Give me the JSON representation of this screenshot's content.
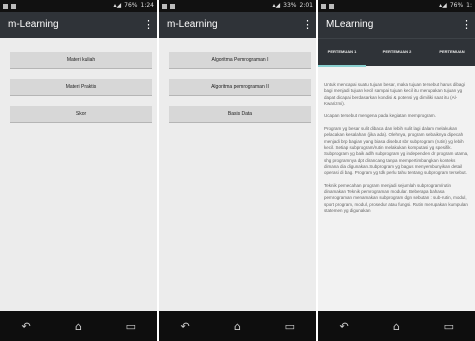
{
  "screens": [
    {
      "status": {
        "time": "1:24",
        "battery": "76%"
      },
      "title": "m-Learning",
      "menu_icon": "⋮",
      "buttons": [
        "Materi kuliah",
        "Materi Praktis",
        "Skor"
      ]
    },
    {
      "status": {
        "time": "2:01",
        "battery": "33%"
      },
      "title": "m-Learning",
      "menu_icon": "⋮",
      "buttons": [
        "Algoritma Pemrograman I",
        "Algoritma pemrograman II",
        "Basis Data"
      ]
    },
    {
      "status": {
        "time": "1:",
        "battery": "76%"
      },
      "title": "MLearning",
      "menu_icon": "⋮",
      "tabs": [
        "PERTEMUAN 1",
        "PERTEMUAN 2",
        "PERTEMUAN"
      ],
      "paragraphs": [
        "Untuk mencapai suatu tujuan besar, maka tujuan tersebut harus dibagi bagi menjadi tujuan kecil sampai tujuan kecil itu merupakan tujuan yg dapat dicapai berdasarkan kondisi & potensi yg dimiliki saat itu (Al-Kwarizmi).",
        "Ucapan tersebut mengena pada kegiatan memprogram.",
        "Program yg besar sulit dibaca dan lebih sulit lagi dalam melakukan pelacakan kesalahan (jika ada). Olehnya, program sebaiknya dipecah menjadi brp bagian yang biasa disebut sbr subprogram (rutin) yg lebih kecil. Setiap subprogram/rutin melakukan komputasi yg spesifik. Subprogram yg baik adlh subprogram yg independen dr program utama, shg programnya dpt dirancang tanpa mempertimbangkan konteks dimana dia digunakan.Subprogram yg bagus menyembunyikan detail operasi di bag. Program yg tdk perlu tahu tentang subprogram tersebut.",
        "Teknik pemecahan program menjadi sejumlah subprogram/rutin dinamakan Teknik pemrograman modular. Beberapa bahasa pemrograman menamakan subprogram dgn sebutan : sub-rutin, modul, sport program, modul, prosedur atau fungsi. Rutin merupakan kumpulan statemen yg digunakan"
      ]
    }
  ],
  "navbar_icons": {
    "back": "↶",
    "home": "⌂",
    "recents": "▭"
  }
}
